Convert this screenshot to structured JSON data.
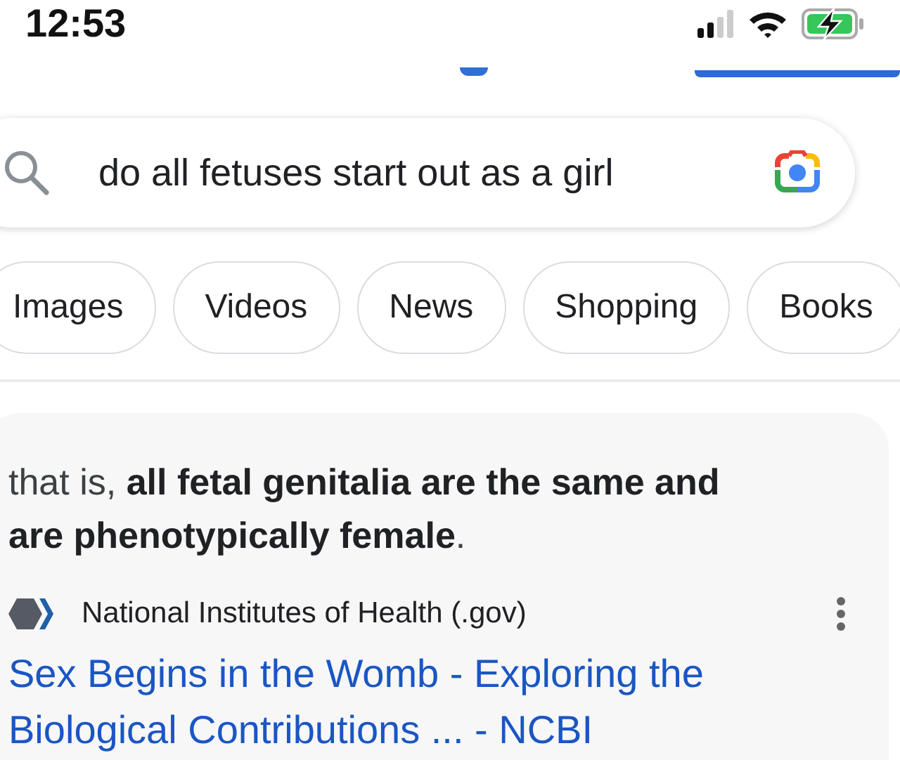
{
  "status_bar": {
    "time": "12:53"
  },
  "search": {
    "query": "do all fetuses start out as a girl"
  },
  "chips": [
    {
      "label": "Images"
    },
    {
      "label": "Videos"
    },
    {
      "label": "News"
    },
    {
      "label": "Shopping"
    },
    {
      "label": "Books"
    }
  ],
  "result": {
    "snippet": "that is, **all fetal genitalia are the same and are phenotypically female**.",
    "source": "National Institutes of Health (.gov)",
    "title": "Sex Begins in the Womb - Exploring the Biological Contributions ... - NCBI"
  }
}
